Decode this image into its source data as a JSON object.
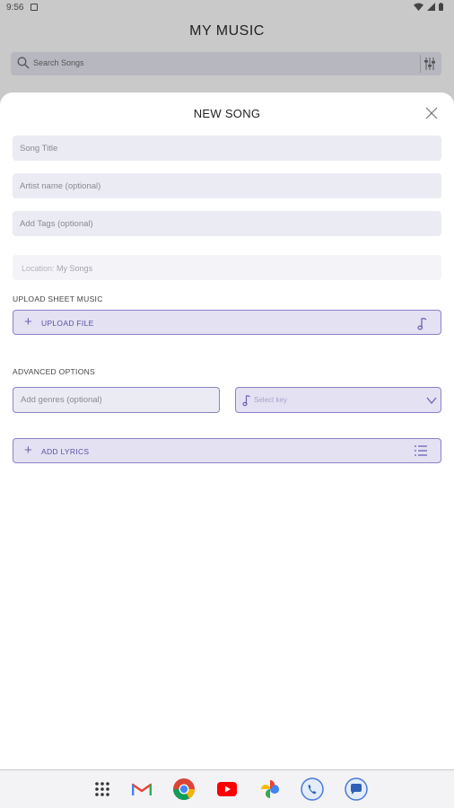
{
  "status_bar": {
    "time": "9:56"
  },
  "app": {
    "title": "MY MUSIC"
  },
  "search": {
    "placeholder": "Search Songs"
  },
  "sheet": {
    "title": "NEW SONG",
    "song_title_placeholder": "Song Title",
    "artist_placeholder": "Artist name (optional)",
    "tags_placeholder": "Add Tags (optional)",
    "location_label": "Location:",
    "location_value": "My Songs",
    "upload_section_label": "UPLOAD SHEET MUSIC",
    "upload_button_label": "UPLOAD FILE",
    "advanced_section_label": "ADVANCED OPTIONS",
    "genres_placeholder": "Add genres (optional)",
    "key_placeholder": "Select key",
    "add_lyrics_label": "ADD LYRICS"
  },
  "dock": {
    "apps": [
      "app-drawer-icon",
      "gmail-icon",
      "chrome-icon",
      "youtube-icon",
      "photos-icon",
      "phone-icon",
      "messages-icon"
    ]
  },
  "colors": {
    "accent": "#8a83c6",
    "accent_fill": "#e3e1f2",
    "field_fill": "#ebebf3"
  }
}
